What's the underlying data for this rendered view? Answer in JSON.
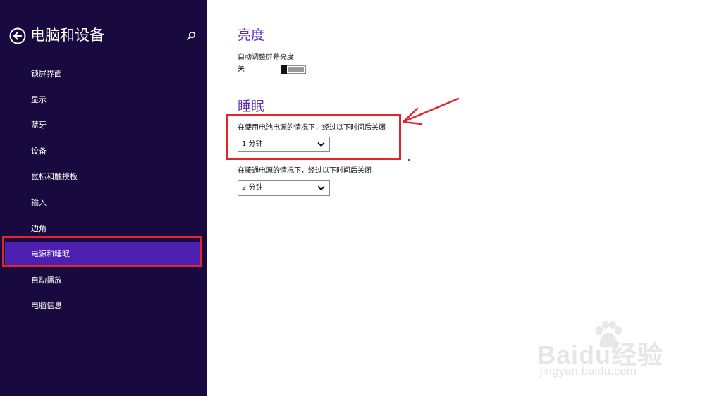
{
  "sidebar": {
    "title": "电脑和设备",
    "items": [
      {
        "label": "锁屏界面"
      },
      {
        "label": "显示"
      },
      {
        "label": "蓝牙"
      },
      {
        "label": "设备"
      },
      {
        "label": "鼠标和触摸板"
      },
      {
        "label": "输入"
      },
      {
        "label": "边角"
      },
      {
        "label": "电源和睡眠",
        "active": true
      },
      {
        "label": "自动播放"
      },
      {
        "label": "电脑信息"
      }
    ]
  },
  "brightness": {
    "heading": "亮度",
    "auto_label": "自动调整屏幕亮度",
    "toggle_state": "关",
    "toggle_on": false
  },
  "sleep": {
    "heading": "睡眠",
    "battery_label": "在使用电池电源的情况下，经过以下时间后关闭",
    "battery_value": "1 分钟",
    "plugged_label": "在接通电源的情况下，经过以下时间后关闭",
    "plugged_value": "2 分钟"
  },
  "watermark": {
    "brand": "Baidu经验",
    "url": "jingyan.baidu.com"
  },
  "colors": {
    "sidebar_bg": "#180a3e",
    "active_item": "#4d20b3",
    "heading": "#5b2fb8",
    "annotation": "#e0252d"
  },
  "icons": {
    "back": "back-arrow-circle-icon",
    "search": "search-icon",
    "dropdown": "chevron-down-icon"
  }
}
